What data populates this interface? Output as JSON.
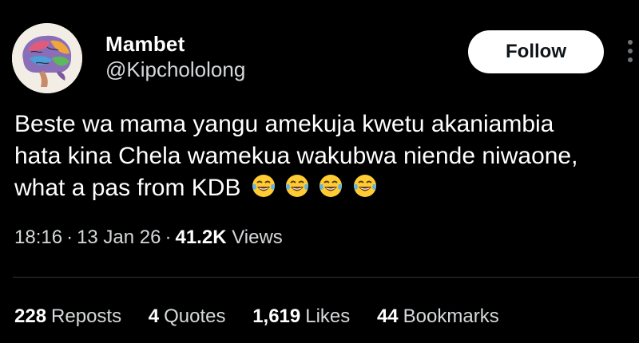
{
  "author": {
    "display_name": "Mambet",
    "handle": "@Kipchololong",
    "avatar_icon": "brain-illustration-avatar"
  },
  "actions": {
    "follow_label": "Follow",
    "more_icon": "more-options-icon"
  },
  "tweet": {
    "lines": [
      "Beste wa mama yangu amekuja kwetu akaniambia",
      "hata kina Chela wamekua wakubwa niende niwaone,",
      "what a pas from KDB"
    ],
    "emoji": [
      "tears-of-joy",
      "tears-of-joy",
      "tears-of-joy",
      "tears-of-joy"
    ]
  },
  "meta": {
    "time": "18:16",
    "separator": "·",
    "date": "13 Jan 26",
    "views_count": "41.2K",
    "views_label": "Views"
  },
  "stats": {
    "reposts": {
      "count": "228",
      "label": "Reposts"
    },
    "quotes": {
      "count": "4",
      "label": "Quotes"
    },
    "likes": {
      "count": "1,619",
      "label": "Likes"
    },
    "bookmarks": {
      "count": "44",
      "label": "Bookmarks"
    }
  },
  "colors": {
    "background": "#000000",
    "text": "#ffffff",
    "secondary_text": "#d6d9db",
    "button_bg": "#ffffff",
    "divider": "#2f3336"
  }
}
